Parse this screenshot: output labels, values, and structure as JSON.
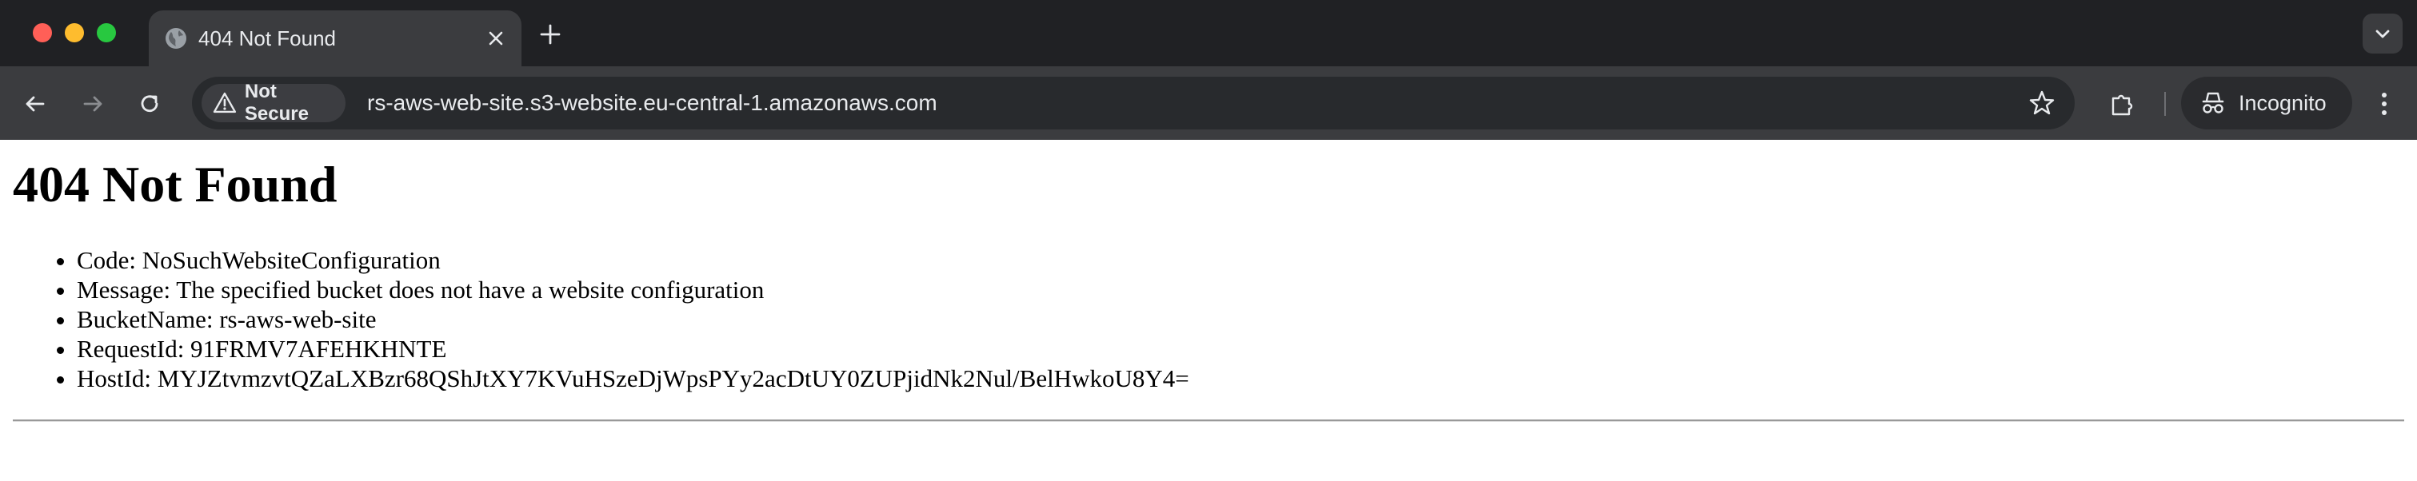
{
  "window": {
    "traffic_lights": {
      "close": "#ff5f57",
      "minimize": "#febc2e",
      "zoom": "#28c840"
    }
  },
  "tab": {
    "title": "404 Not Found",
    "favicon": "globe-icon"
  },
  "toolbar": {
    "back_icon": "arrow-left-icon",
    "forward_icon": "arrow-right-icon",
    "reload_icon": "reload-icon",
    "security_label": "Not Secure",
    "url": "rs-aws-web-site.s3-website.eu-central-1.amazonaws.com",
    "incognito_label": "Incognito"
  },
  "page": {
    "heading": "404 Not Found",
    "items": [
      "Code: NoSuchWebsiteConfiguration",
      "Message: The specified bucket does not have a website configuration",
      "BucketName: rs-aws-web-site",
      "RequestId: 91FRMV7AFEHKHNTE",
      "HostId: MYJZtvmzvtQZaLXBzr68QShJtXY7KVuHSzeDjWpsPYy2acDtUY0ZUPjidNk2Nul/BelHwkoU8Y4="
    ]
  },
  "colors": {
    "tabstrip": "#202124",
    "toolbar": "#3b3c3f",
    "omnibox": "#282a2d",
    "text_light": "#e8eaed"
  }
}
